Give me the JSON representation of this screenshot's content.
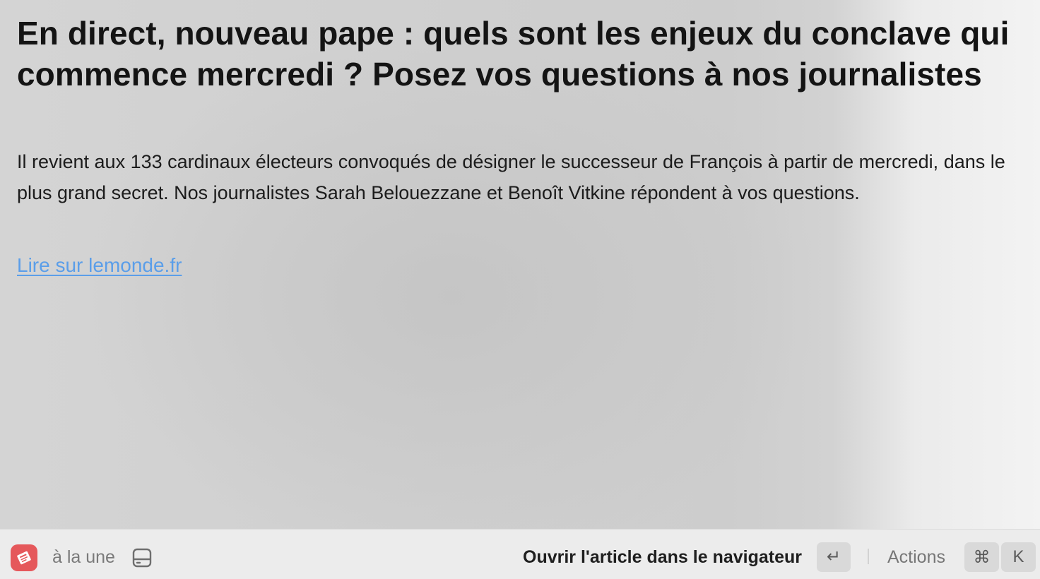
{
  "article": {
    "headline": "En direct, nouveau pape : quels sont les enjeux du conclave qui commence mercredi ? Posez vos questions à nos journalistes",
    "summary": "Il revient aux 133 cardinaux électeurs convoqués de désigner le successeur de François à partir de mercredi, dans le plus grand secret. Nos journalistes Sarah Belouezzane et Benoît Vitkine répondent à vos questions.",
    "link_text": "Lire sur lemonde.fr"
  },
  "footer": {
    "app_icon": "newspaper-app-icon",
    "feed_label": "à la une",
    "feed_icon": "inbox-tray-icon",
    "primary_action_label": "Ouvrir l'article dans le navigateur",
    "primary_shortcut": "↵",
    "actions_label": "Actions",
    "actions_shortcut_modifier": "⌘",
    "actions_shortcut_key": "K"
  },
  "colors": {
    "link": "#5b9ee9",
    "app_icon_bg": "#e5585b"
  }
}
